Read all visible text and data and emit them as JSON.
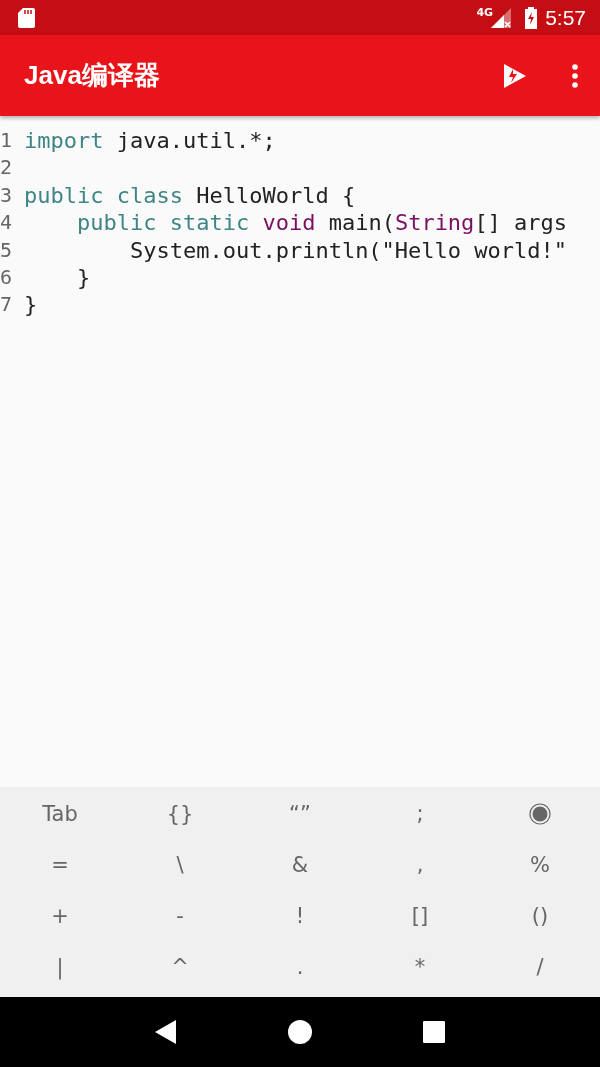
{
  "status_bar": {
    "time": "5:57",
    "network": "4G"
  },
  "app_bar": {
    "title": "Java编译器"
  },
  "editor": {
    "lines": [
      {
        "number": "1",
        "tokens": [
          {
            "kind": "keyword",
            "text": "import"
          },
          {
            "kind": "plain",
            "text": " java.util.*;"
          }
        ]
      },
      {
        "number": "2"
      },
      {
        "number": "3",
        "tokens": [
          {
            "kind": "keyword",
            "text": "public class"
          },
          {
            "kind": "plain",
            "text": " HelloWorld {"
          }
        ]
      },
      {
        "number": "4",
        "tokens": [
          {
            "kind": "keyword",
            "text": "    public static "
          },
          {
            "kind": "type",
            "text": "void"
          },
          {
            "kind": "plain",
            "text": " main("
          },
          {
            "kind": "type",
            "text": "String"
          },
          {
            "kind": "plain",
            "text": "[] args"
          }
        ]
      },
      {
        "number": "5",
        "tokens": [
          {
            "kind": "plain",
            "text": "        System.out.println(\"Hello world!\""
          }
        ]
      },
      {
        "number": "6",
        "tokens": [
          {
            "kind": "plain",
            "text": "    }"
          }
        ]
      },
      {
        "number": "7",
        "tokens": [
          {
            "kind": "plain",
            "text": "}"
          }
        ]
      }
    ]
  },
  "symbol_keys": [
    {
      "kind": "text",
      "label": "Tab"
    },
    {
      "kind": "text",
      "label": "{}"
    },
    {
      "kind": "text",
      "label": "“”"
    },
    {
      "kind": "text",
      "label": ";"
    },
    {
      "kind": "icon"
    },
    {
      "kind": "text",
      "label": "="
    },
    {
      "kind": "text",
      "label": "\\"
    },
    {
      "kind": "text",
      "label": "&"
    },
    {
      "kind": "text",
      "label": ","
    },
    {
      "kind": "text",
      "label": "%"
    },
    {
      "kind": "text",
      "label": "+"
    },
    {
      "kind": "text",
      "label": "-"
    },
    {
      "kind": "text",
      "label": "!"
    },
    {
      "kind": "text",
      "label": "[]"
    },
    {
      "kind": "text",
      "label": "()"
    },
    {
      "kind": "text",
      "label": "|"
    },
    {
      "kind": "text",
      "label": "^"
    },
    {
      "kind": "text",
      "label": "."
    },
    {
      "kind": "text",
      "label": "*"
    },
    {
      "kind": "text",
      "label": "/"
    }
  ]
}
